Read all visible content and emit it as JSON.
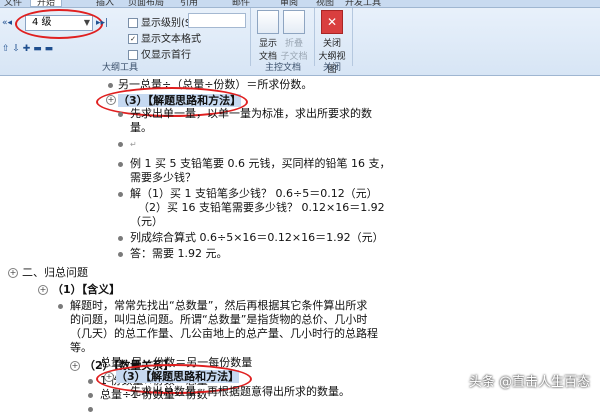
{
  "ribbon": {
    "tabs": [
      "文件",
      "开始",
      "插入",
      "页面布局",
      "引用",
      "邮件",
      "审阅",
      "视图",
      "开发工具"
    ],
    "level_select": "4 级",
    "show_level_label": "显示级别(S):",
    "show_text_format": "显示文本格式",
    "show_first_line_only": "仅显示首行",
    "outline_tools_label": "大纲工具",
    "master_doc": {
      "show_doc_top": "显示",
      "show_doc_bottom": "文档",
      "collapse_top": "折叠",
      "collapse_bottom": "子文档",
      "group_label": "主控文档"
    },
    "close": {
      "top": "关闭",
      "bottom": "大纲视图",
      "group_label": "关闭"
    }
  },
  "doc": {
    "l1": "另一总量÷（总量÷份数）＝所求份数。",
    "l2": "（3）【解题思路和方法】",
    "l3a": "先求出单一量，以单一量为标准，求出所要求的数",
    "l3b": "量。",
    "l4": "",
    "l5a": "例 1 买 5 支铅笔要 0.6 元钱，买同样的铅笔 16 支，",
    "l5b": "需要多少钱？",
    "l6a": "解（1）买 1 支铅笔多少钱？ 0.6÷5＝0.12（元）",
    "l6b": "（2）买 16 支铅笔需要多少钱？ 0.12×16＝1.92",
    "l6c": "（元）",
    "l7": "列成综合算式 0.6÷5×16＝0.12×16＝1.92（元）",
    "l8": "答：需要 1.92 元。",
    "h2": "二、归总问题",
    "h2a": "（1）【含义】",
    "p1a": "解题时，常常先找出“总数量”，然后再根据其它条件算出所求",
    "p1b": "的问题，叫归总问题。所谓“总数量”是指货物的总价、几小时",
    "p1c": "（几天）的总工作量、几公亩地上的总产量、几小时行的总路程",
    "p1d": "等。",
    "h2b": "（2）【数量关系】",
    "q1": "1 份数量×份数＝总量",
    "q2": "总量÷1 份数量＝份数",
    "q3": "总量÷另一份数＝另一每份数量",
    "h2c": "（3）【解题思路和方法】",
    "q4": "先求出总数量，再根据题意得出所求的数量。"
  },
  "watermark": "头条 @直击人生百态"
}
